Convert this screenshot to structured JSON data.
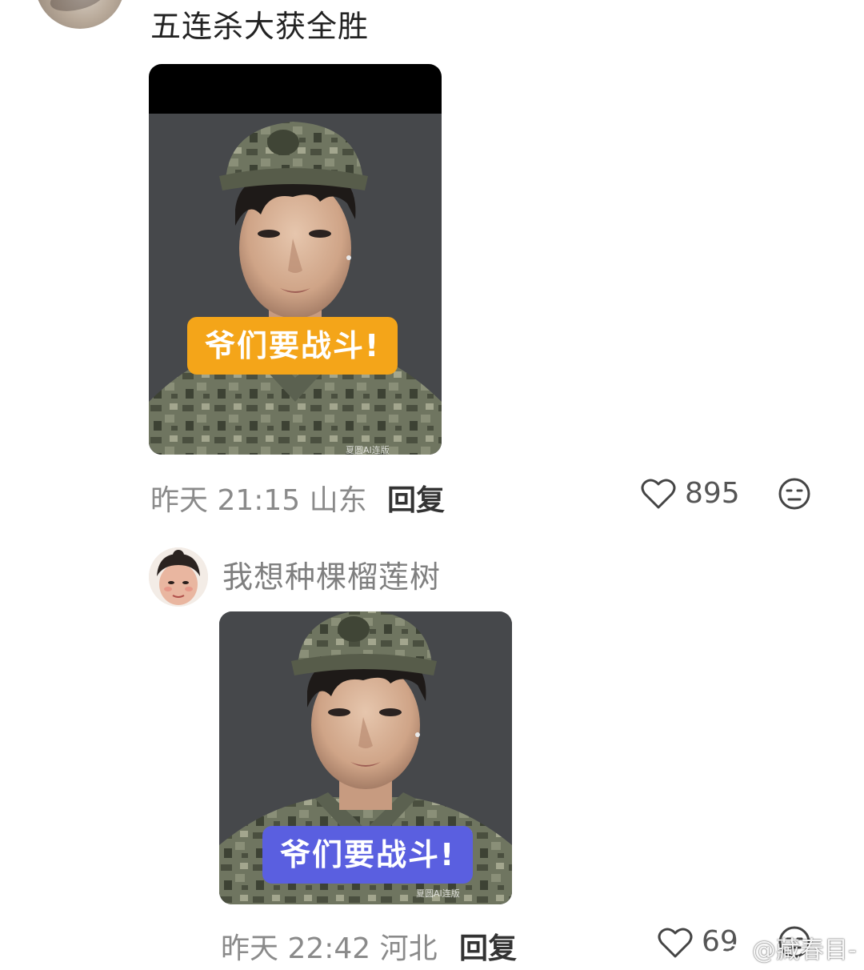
{
  "comment1": {
    "text": "五连杀大获全胜",
    "image": {
      "caption": "爷们要战斗!",
      "watermark": "夏圆AI连版",
      "caption_color": "#f4a519"
    },
    "meta": {
      "time": "昨天 21:15",
      "location": "山东",
      "reply_label": "回复",
      "likes": "895"
    }
  },
  "comment2": {
    "username": "我想种棵榴莲树",
    "image": {
      "caption": "爷们要战斗!",
      "watermark": "夏圆AI连版",
      "caption_color": "#5a5fe0"
    },
    "meta": {
      "time": "昨天 22:42",
      "location": "河北",
      "reply_label": "回复",
      "likes": "69"
    }
  },
  "watermark": {
    "text": "@藏春目-"
  },
  "icons": [
    "heart-icon",
    "dislike-face-icon",
    "weibo-logo-icon"
  ]
}
